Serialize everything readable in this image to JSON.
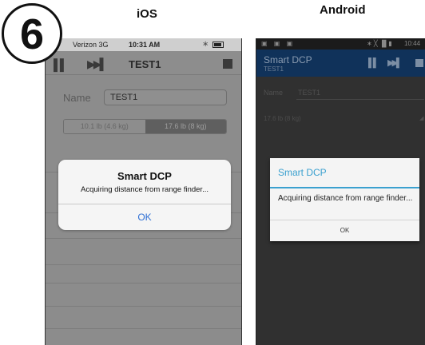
{
  "step_number": "6",
  "labels": {
    "ios": "iOS",
    "android": "Android"
  },
  "ios": {
    "status": {
      "carrier": "Verizon  3G",
      "time": "10:31 AM"
    },
    "navbar": {
      "title": "TEST1"
    },
    "form": {
      "name_label": "Name",
      "name_value": "TEST1",
      "weight_options": [
        "10.1 lb (4.6 kg)",
        "17.6 lb (8 kg)"
      ],
      "weight_selected": "17.6 lb (8 kg)"
    },
    "dialog": {
      "title": "Smart DCP",
      "message": "Acquiring distance from range finder...",
      "ok_label": "OK"
    }
  },
  "android": {
    "status": {
      "time": "10:44"
    },
    "actionbar": {
      "title": "Smart DCP",
      "subtitle": "TEST1"
    },
    "form": {
      "name_label": "Name",
      "name_value": "TEST1",
      "weight_value": "17.6 lb (8 kg)"
    },
    "dialog": {
      "title": "Smart DCP",
      "message": "Acquiring distance from range finder...",
      "ok_label": "OK"
    }
  },
  "colors": {
    "ios_dialog_button": "#2f6fd4",
    "android_accent": "#3aa0cf",
    "android_actionbar": "#10325a"
  },
  "icons": {
    "ios_navbar": [
      "pause-icon",
      "skip-forward-icon",
      "stop-icon"
    ],
    "android_actionbar": [
      "pause-icon",
      "skip-forward-icon",
      "stop-icon"
    ],
    "ios_status": [
      "bluetooth-icon",
      "battery-icon"
    ],
    "android_status": [
      "notification-icons",
      "bluetooth-icon",
      "signal-icon",
      "battery-icon"
    ]
  }
}
